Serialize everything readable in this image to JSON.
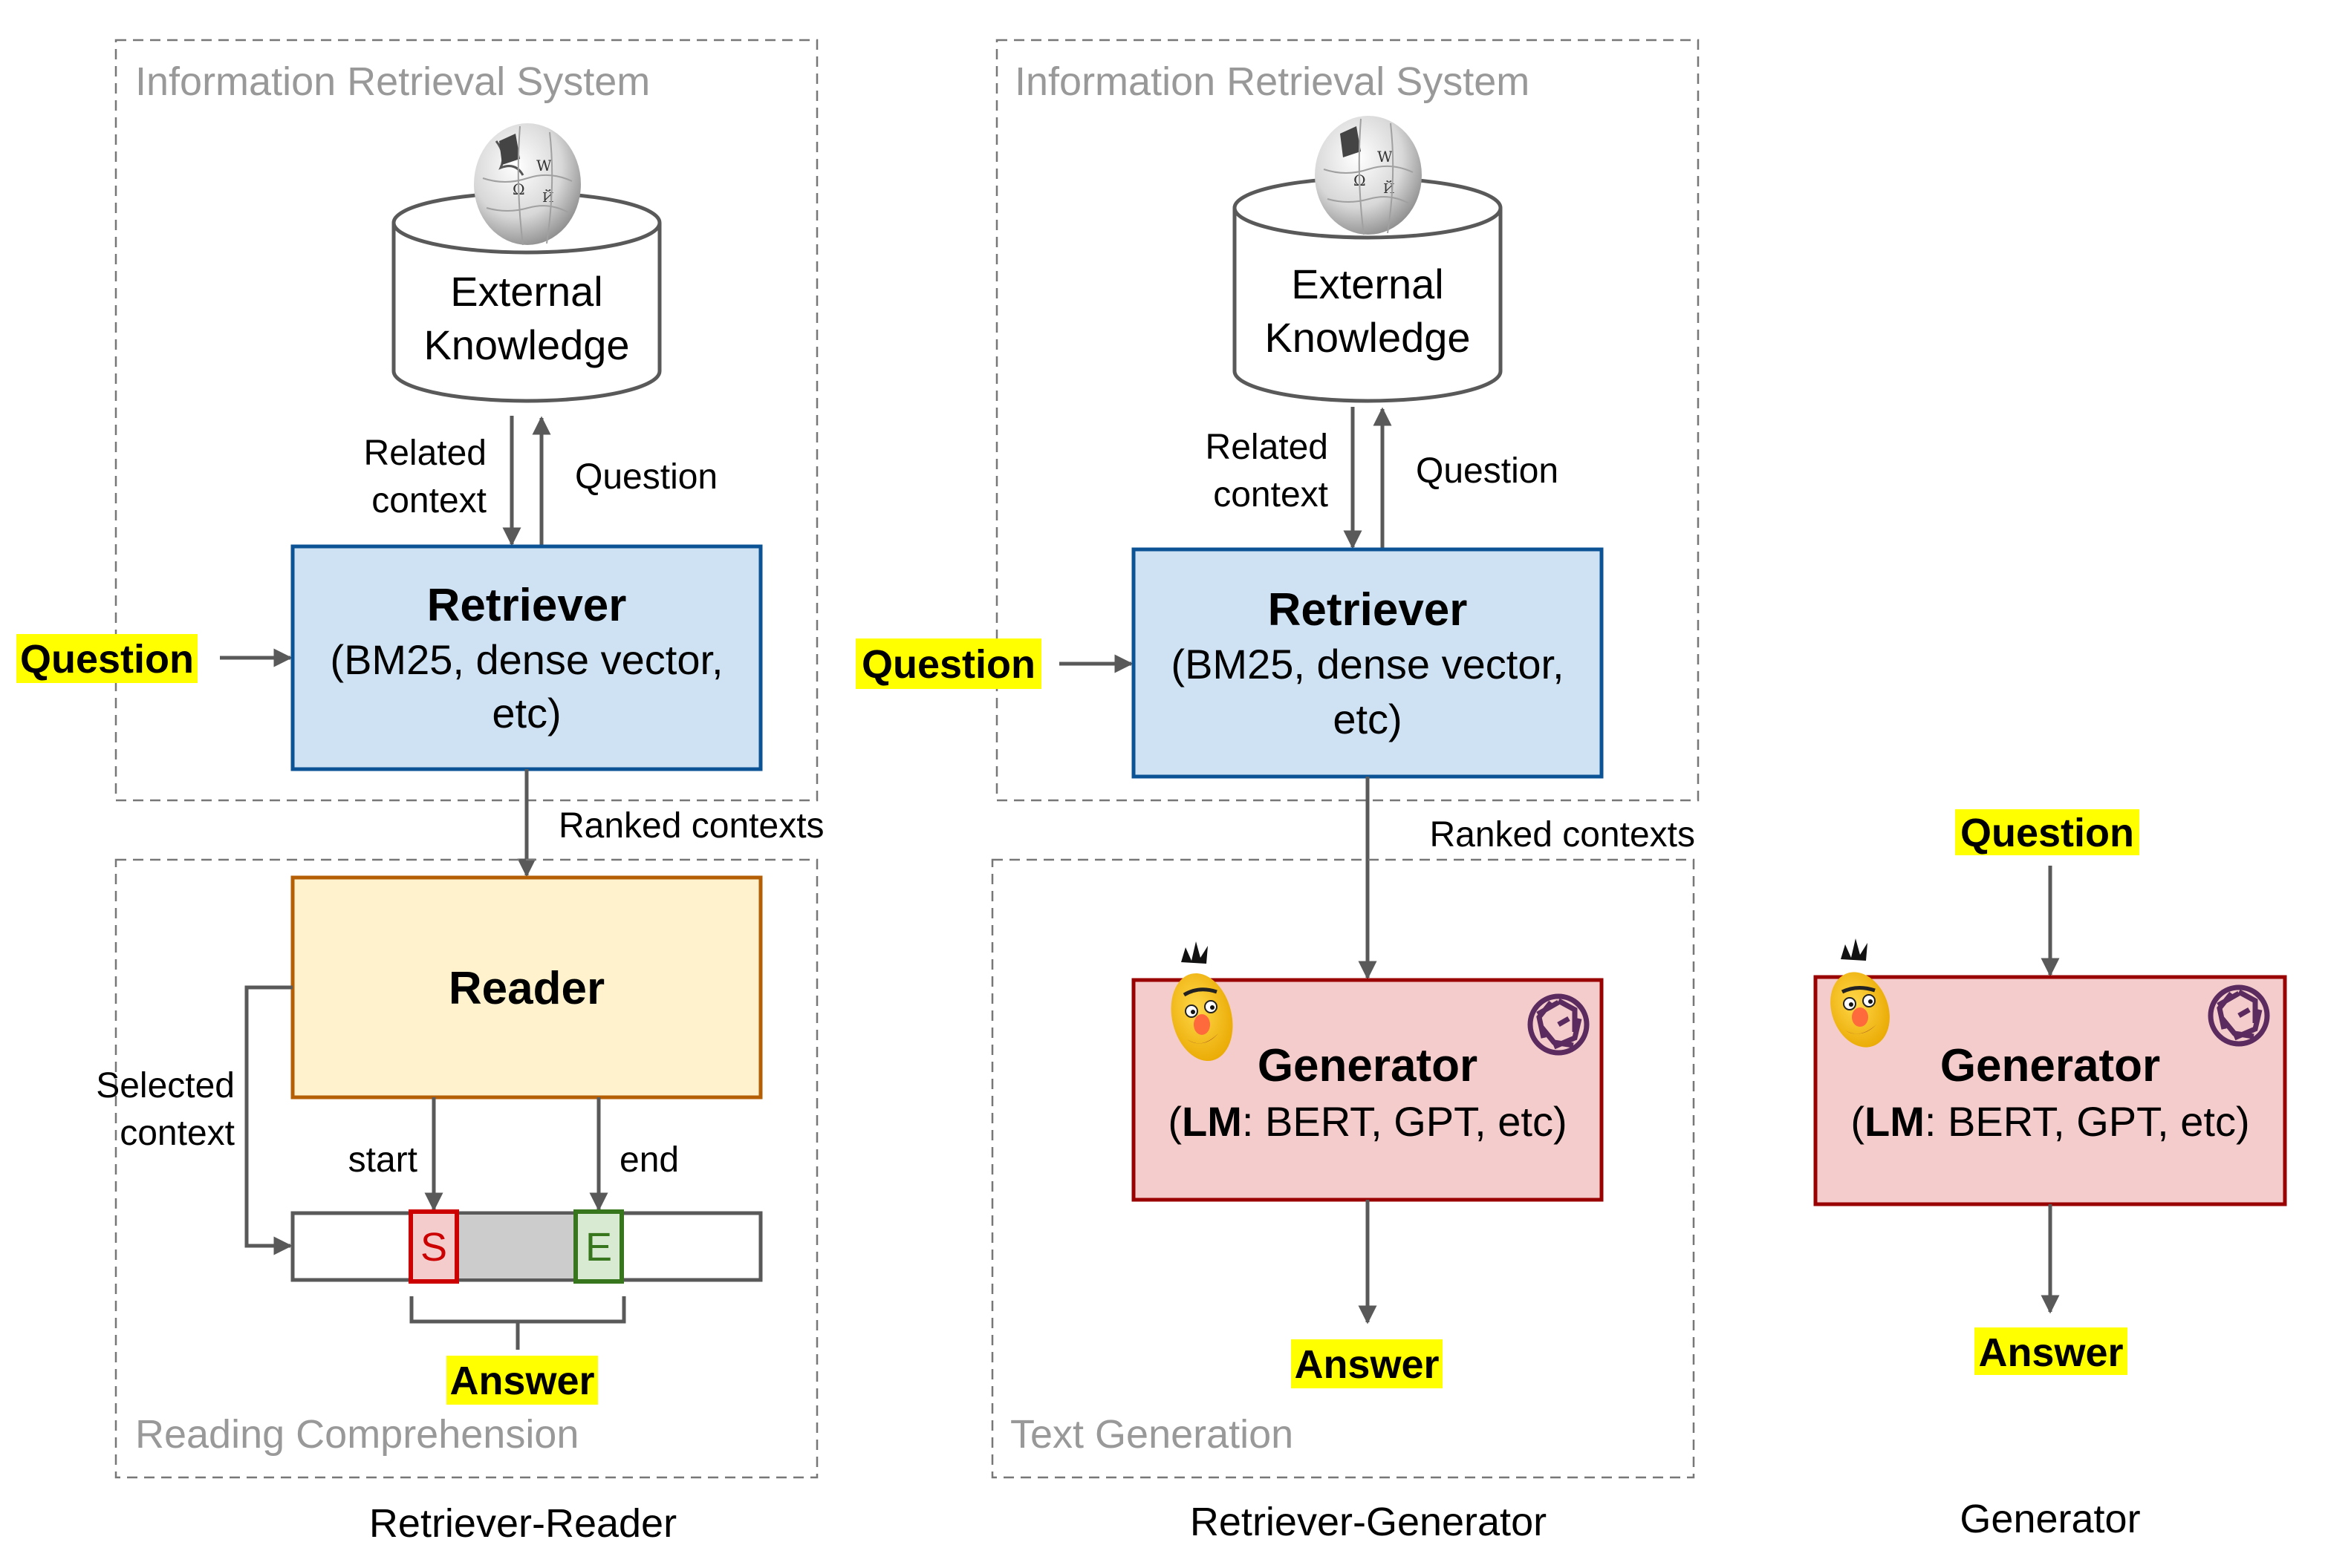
{
  "diagram": {
    "colors": {
      "arrow": "#595959",
      "dashed_border": "#777777",
      "group_title": "#999999",
      "highlight": "#ffff00",
      "retriever_fill": "#cfe2f3",
      "retriever_border": "#0b5394",
      "reader_fill": "#fff2cc",
      "reader_border": "#b45f06",
      "generator_fill": "#f4cccc",
      "generator_border": "#990000",
      "start_fill": "#f4cccc",
      "start_border": "#cc0000",
      "end_fill": "#d9ead3",
      "end_border": "#38761d",
      "span_fill": "#cccccc",
      "openai_logo": "#5b2a5e"
    },
    "panels": [
      {
        "caption": "Retriever-Reader",
        "groups": [
          "Information Retrieval System",
          "Reading Comprehension"
        ],
        "knowledge_store": {
          "line1": "External",
          "line2": "Knowledge",
          "icon": "wikipedia-globe-icon"
        },
        "edge_labels": {
          "related_context_1": "Related",
          "related_context_2": "context",
          "question_up": "Question",
          "ranked": "Ranked contexts",
          "selected_1": "Selected",
          "selected_2": "context",
          "start": "start",
          "end": "end"
        },
        "input": "Question",
        "retriever": {
          "title": "Retriever",
          "sub1": "(BM25, dense vector,",
          "sub2": "etc)"
        },
        "reader": {
          "title": "Reader"
        },
        "span": {
          "start_token": "S",
          "end_token": "E"
        },
        "output": "Answer"
      },
      {
        "caption": "Retriever-Generator",
        "groups": [
          "Information Retrieval System",
          "Text Generation"
        ],
        "knowledge_store": {
          "line1": "External",
          "line2": "Knowledge",
          "icon": "wikipedia-globe-icon"
        },
        "edge_labels": {
          "related_context_1": "Related",
          "related_context_2": "context",
          "question_up": "Question",
          "ranked": "Ranked contexts"
        },
        "input": "Question",
        "retriever": {
          "title": "Retriever",
          "sub1": "(BM25, dense vector,",
          "sub2": "etc)"
        },
        "generator": {
          "title": "Generator",
          "sub_bold": "LM",
          "sub_rest": ": BERT, GPT, etc)",
          "sub_open": "(",
          "icons": [
            "bert-muppet-icon",
            "openai-logo-icon"
          ]
        },
        "output": "Answer"
      },
      {
        "caption": "Generator",
        "input": "Question",
        "generator": {
          "title": "Generator",
          "sub_bold": "LM",
          "sub_rest": ": BERT, GPT, etc)",
          "sub_open": "(",
          "icons": [
            "bert-muppet-icon",
            "openai-logo-icon"
          ]
        },
        "output": "Answer"
      }
    ]
  }
}
